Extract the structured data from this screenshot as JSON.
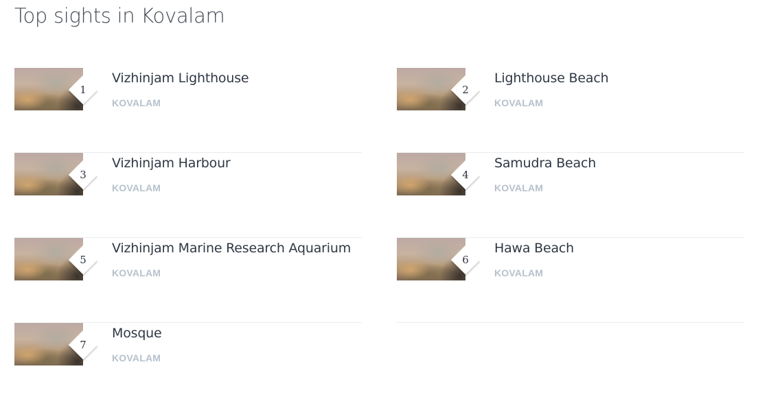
{
  "page": {
    "title": "Top sights in Kovalam"
  },
  "sights": [
    {
      "rank": "1",
      "name": "Vizhinjam Lighthouse",
      "location": "KOVALAM"
    },
    {
      "rank": "2",
      "name": "Lighthouse Beach",
      "location": "KOVALAM"
    },
    {
      "rank": "3",
      "name": "Vizhinjam Harbour",
      "location": "KOVALAM"
    },
    {
      "rank": "4",
      "name": "Samudra Beach",
      "location": "KOVALAM"
    },
    {
      "rank": "5",
      "name": "Vizhinjam Marine Research Aquarium",
      "location": "KOVALAM"
    },
    {
      "rank": "6",
      "name": "Hawa Beach",
      "location": "KOVALAM"
    },
    {
      "rank": "7",
      "name": "Mosque",
      "location": "KOVALAM"
    }
  ],
  "colors": {
    "title": "#434a54",
    "name": "#2f3844",
    "location": "#b6c1cc",
    "divider": "#e8ebee"
  }
}
